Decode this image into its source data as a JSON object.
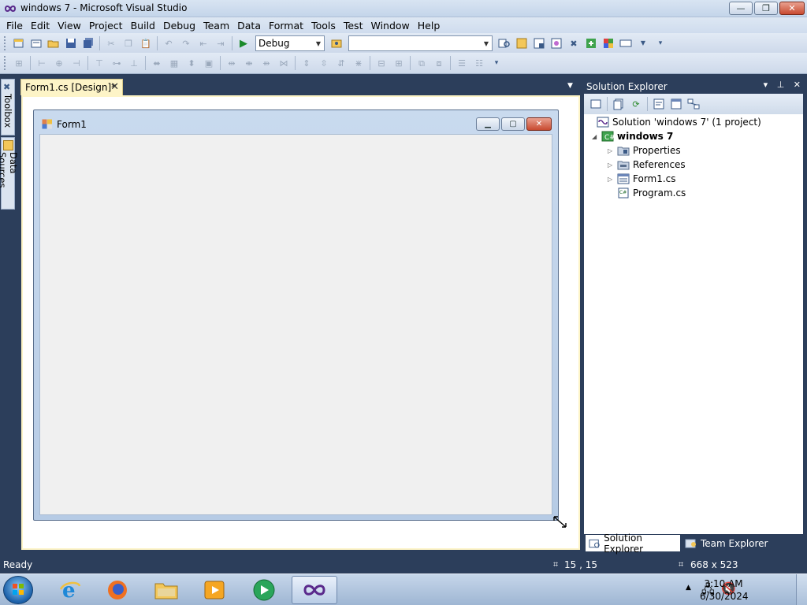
{
  "window": {
    "title": "windows 7 - Microsoft Visual Studio",
    "minimize": "—",
    "maximize": "❐",
    "close": "✕"
  },
  "menu": [
    "File",
    "Edit",
    "View",
    "Project",
    "Build",
    "Debug",
    "Team",
    "Data",
    "Format",
    "Tools",
    "Test",
    "Window",
    "Help"
  ],
  "toolbar": {
    "configuration": "Debug",
    "platform": ""
  },
  "left_strip": {
    "toolbox": "Toolbox",
    "data_sources": "Data Sources"
  },
  "document_tab": {
    "label": "Form1.cs [Design]*",
    "close": "✕"
  },
  "designer_form": {
    "title": "Form1"
  },
  "solution_explorer": {
    "title": "Solution Explorer",
    "header_buttons": "▾ ⊥ ✕",
    "tree": [
      {
        "label": "Solution 'windows 7' (1 project)",
        "expander": ""
      },
      {
        "label": "windows 7",
        "expander": "◢"
      },
      {
        "label": "Properties",
        "expander": "▷"
      },
      {
        "label": "References",
        "expander": "▷"
      },
      {
        "label": "Form1.cs",
        "expander": "▷"
      },
      {
        "label": "Program.cs",
        "expander": ""
      }
    ],
    "tabs": [
      "Solution Explorer",
      "Team Explorer"
    ]
  },
  "status": {
    "text": "Ready",
    "position": "15 , 15",
    "size": "668 x 523"
  },
  "taskbar": {
    "time": "3:10 AM",
    "date": "6/30/2024"
  },
  "colors": {
    "ide_background": "#2c3e5b",
    "designer_tab": "#fdf4c7",
    "form_client": "#f0f0f0"
  }
}
